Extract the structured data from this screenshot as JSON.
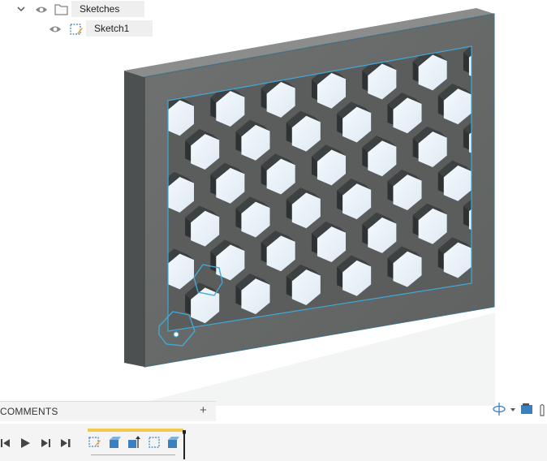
{
  "browser": {
    "sketches_folder": {
      "label": "Sketches",
      "expanded": true,
      "visible": true
    },
    "sketch1": {
      "label": "Sketch1",
      "visible": true
    }
  },
  "comments": {
    "label": "COMMENTS",
    "add_symbol": "+"
  },
  "timeline": {
    "playback": [
      "previous-step",
      "play",
      "next-step",
      "end"
    ],
    "features": [
      "sketch",
      "extrude",
      "extrude",
      "sketch",
      "extrude"
    ]
  },
  "colors": {
    "model_face": "#6b6e6c",
    "model_edge": "#3c4040",
    "selection": "#3fa9d9",
    "accent_timeline": "#f2c94c"
  }
}
